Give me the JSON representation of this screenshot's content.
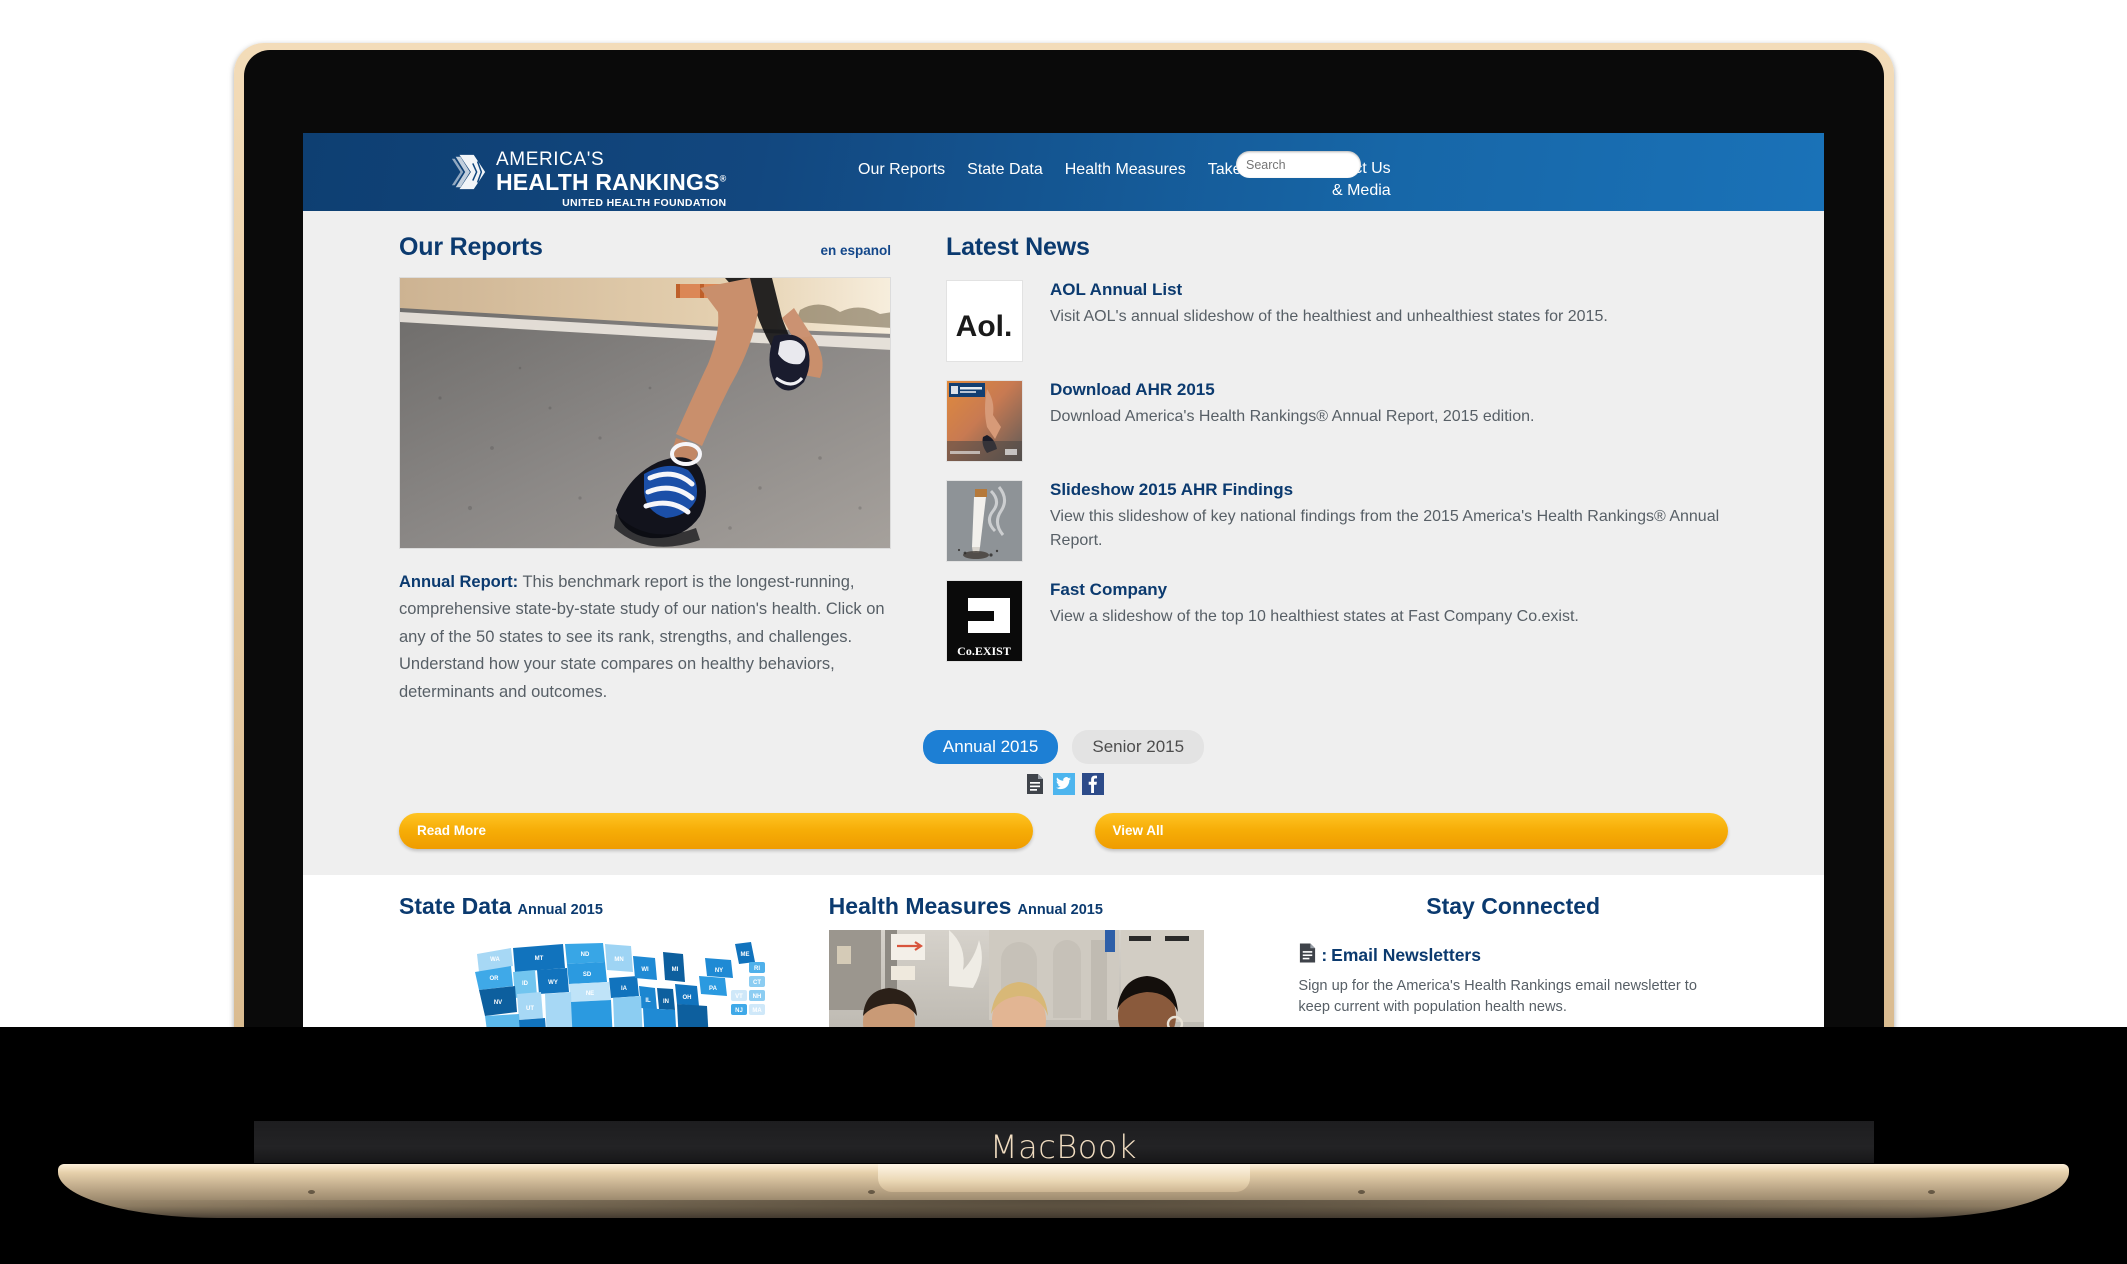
{
  "device": {
    "brand_label": "MacBook"
  },
  "header": {
    "logo": {
      "line1": "AMERICA'S",
      "line2": "HEALTH RANKINGS",
      "trademark": "®",
      "line3": "UNITED HEALTH FOUNDATION"
    },
    "nav": [
      {
        "label": "Our Reports"
      },
      {
        "label": "State Data"
      },
      {
        "label": "Health Measures"
      },
      {
        "label": "Take Action"
      }
    ],
    "contact": {
      "line1": "Contact Us",
      "line2": "& Media"
    },
    "search": {
      "placeholder": "Search",
      "value": "",
      "icon": "search-icon"
    },
    "colors": {
      "bar_left": "#0e3f72",
      "bar_right": "#1a72b8",
      "search_button": "#f3a807"
    }
  },
  "reports": {
    "heading": "Our Reports",
    "espanol_link": "en espanol",
    "hero_alt": "runner-on-road-photo",
    "blurb_label": "Annual Report:",
    "blurb_text": " This benchmark report is the longest-running, comprehensive state-by-state study of our nation's health. Click on any of the 50 states to see its rank, strengths, and challenges. Understand how your state compares on healthy behaviors, determinants and outcomes."
  },
  "latest_news": {
    "heading": "Latest News",
    "items": [
      {
        "thumb": "aol-logo",
        "title": "AOL Annual List",
        "desc": "Visit AOL's annual slideshow of the healthiest and unhealthiest states for 2015."
      },
      {
        "thumb": "ahr-report-cover",
        "title": "Download AHR 2015",
        "desc": "Download America's Health Rankings® Annual Report, 2015 edition."
      },
      {
        "thumb": "cigarette-smoke-photo",
        "title": "Slideshow 2015 AHR Findings",
        "desc": "View this slideshow of key national findings from the 2015 America's Health Rankings® Annual Report."
      },
      {
        "thumb": "fast-company-coexist-logo",
        "title": "Fast Company",
        "desc": "View a slideshow of the top 10 healthiest states at Fast Company Co.exist."
      }
    ]
  },
  "tabs": [
    {
      "label": "Annual 2015",
      "active": true
    },
    {
      "label": "Senior 2015",
      "active": false
    }
  ],
  "share": [
    {
      "icon": "document-icon",
      "name": "document"
    },
    {
      "icon": "twitter-icon",
      "name": "twitter"
    },
    {
      "icon": "facebook-icon",
      "name": "facebook"
    }
  ],
  "buttons": {
    "read_more": "Read More",
    "view_all": "View All"
  },
  "bottom": {
    "state_data": {
      "title": "State Data",
      "subtitle": "Annual 2015",
      "image_alt": "us-choropleth-map"
    },
    "health_measures": {
      "title": "Health Measures",
      "subtitle": "Annual 2015",
      "image_alt": "three-women-smiling-photo"
    },
    "stay_connected": {
      "title": "Stay Connected",
      "item_icon": "document-icon",
      "item_separator": ":",
      "item_title": "Email Newsletters",
      "item_desc": "Sign up for the America's Health Rankings email newsletter to keep current with population health news."
    }
  },
  "map_states": [
    "WA",
    "OR",
    "MT",
    "ID",
    "ND",
    "SD",
    "WY",
    "NV",
    "UT",
    "NE",
    "MN",
    "IA",
    "WI",
    "MI",
    "IL",
    "IN",
    "OH",
    "PA",
    "NY",
    "ME",
    "RI",
    "CT",
    "VT",
    "NH",
    "NJ",
    "MA"
  ]
}
